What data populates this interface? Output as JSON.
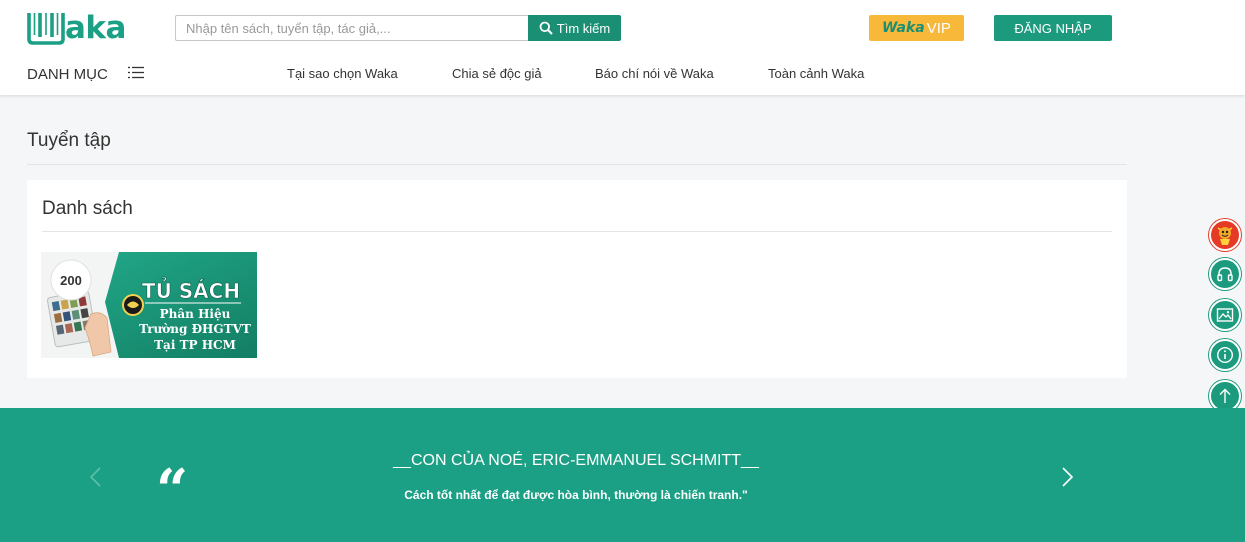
{
  "brand": {
    "logo_text": "aka",
    "accent_color": "#1ba085",
    "dark_accent": "#1b8f73",
    "vip_color": "#f8b83a"
  },
  "header": {
    "search": {
      "placeholder": "Nhập tên sách, tuyển tập, tác giả,...",
      "value": "",
      "button_label": "Tìm kiếm",
      "button_icon": "search-icon"
    },
    "vip": {
      "brand": "Waka",
      "label": "VIP"
    },
    "login_label": "ĐĂNG NHẬP",
    "category_label": "DANH MỤC",
    "category_icon": "list-menu-icon",
    "nav": [
      {
        "label": "Tại sao chọn Waka"
      },
      {
        "label": "Chia sẻ độc giả"
      },
      {
        "label": "Báo chí nói về Waka"
      },
      {
        "label": "Toàn cảnh Waka"
      }
    ]
  },
  "main": {
    "section_title": "Tuyển tập",
    "panel_title": "Danh sách",
    "collection": {
      "count": "200",
      "title": "TỦ SÁCH",
      "line1": "Phân Hiệu",
      "line2": "Trường ĐHGTVT",
      "line3": "Tại TP HCM"
    }
  },
  "side_buttons": [
    {
      "icon": "mascot-icon"
    },
    {
      "icon": "headphones-icon"
    },
    {
      "icon": "image-icon"
    },
    {
      "icon": "info-icon"
    },
    {
      "icon": "arrow-up-icon"
    }
  ],
  "footer": {
    "quote_source": "__CON CỦA NOÉ, ERIC-EMMANUEL SCHMITT__",
    "quote_text": "Cách tốt nhất để đạt được hòa bình, thường là chiến tranh.\"",
    "quote_mark": "“"
  }
}
